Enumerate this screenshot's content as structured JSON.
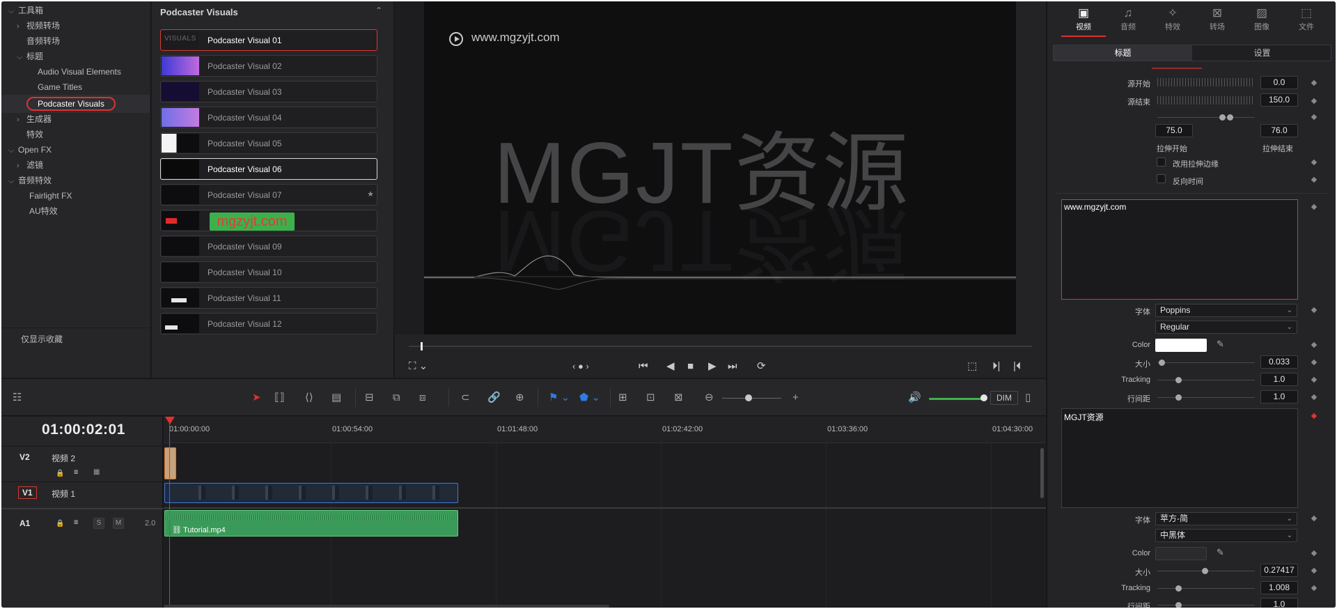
{
  "tree": {
    "items": [
      {
        "label": "工具箱",
        "chev": "⌵",
        "indent": 0
      },
      {
        "label": "视频转场",
        "chev": "›",
        "indent": 1
      },
      {
        "label": "音频转场",
        "chev": "",
        "indent": 1
      },
      {
        "label": "标题",
        "chev": "⌵",
        "indent": 1
      },
      {
        "label": "Audio Visual Elements",
        "chev": "",
        "indent": 2
      },
      {
        "label": "Game Titles",
        "chev": "",
        "indent": 2
      },
      {
        "label": "Podcaster Visuals",
        "chev": "",
        "indent": 2
      },
      {
        "label": "生成器",
        "chev": "›",
        "indent": 1
      },
      {
        "label": "特效",
        "chev": "",
        "indent": 1
      },
      {
        "label": "Open FX",
        "chev": "⌵",
        "indent": 0
      },
      {
        "label": "滤镜",
        "chev": "›",
        "indent": 1
      },
      {
        "label": "音频特效",
        "chev": "⌵",
        "indent": 0
      },
      {
        "label": "Fairlight FX",
        "chev": "",
        "indent": 1
      },
      {
        "label": "AU特效",
        "chev": "",
        "indent": 1
      }
    ],
    "favorites_only": "仅显示收藏"
  },
  "titles_panel": {
    "header": "Podcaster Visuals",
    "collapse_icon": "chevron-up-icon",
    "cards": [
      "Podcaster Visual 01",
      "Podcaster Visual 02",
      "Podcaster Visual 03",
      "Podcaster Visual 04",
      "Podcaster Visual 05",
      "Podcaster Visual 06",
      "Podcaster Visual 07",
      "",
      "Podcaster Visual 09",
      "Podcaster Visual 10",
      "Podcaster Visual 11",
      "Podcaster Visual 12"
    ],
    "thumb_label_01": "VISUALS",
    "watermark": "mgzyjt.com"
  },
  "viewer": {
    "url_text": "www.mgzyjt.com",
    "big_title": "MGJT资源"
  },
  "inspector": {
    "tabs": [
      "视频",
      "音频",
      "特效",
      "转场",
      "图像",
      "文件"
    ],
    "tab_icons": [
      "▣",
      "♫",
      "✧",
      "⊠",
      "▨",
      "⬚"
    ],
    "sub_tabs": [
      "标题",
      "设置"
    ],
    "source_start_label": "源开始",
    "source_start_value": "0.0",
    "source_end_label": "源结束",
    "source_end_value": "150.0",
    "stretch_start_value": "75.0",
    "stretch_end_value": "76.0",
    "stretch_start_label": "拉伸开始",
    "stretch_end_label": "拉伸结束",
    "use_stretch_edge_label": "改用拉伸边缘",
    "reverse_time_label": "反向时间",
    "text1": "www.mgzyjt.com",
    "font_label": "字体",
    "font1": "Poppins",
    "style1": "Regular",
    "color_label": "Color",
    "size_label": "大小",
    "size1": "0.033",
    "tracking_label": "Tracking",
    "tracking1": "1.0",
    "line_spacing_label": "行间距",
    "line_spacing1": "1.0",
    "text2": "MGJT资源",
    "font2": "苹方-简",
    "style2": "中黑体",
    "size2": "0.27417",
    "tracking2": "1.008",
    "line_spacing2": "1.0"
  },
  "toolbar": {
    "dim": "DIM"
  },
  "timeline": {
    "timecode": "01:00:02:01",
    "ruler": [
      "01:00:00:00",
      "01:00:54:00",
      "01:01:48:00",
      "01:02:42:00",
      "01:03:36:00",
      "01:04:30:00"
    ],
    "tracks": {
      "v2_id": "V2",
      "v2_name": "视频 2",
      "v1_id": "V1",
      "v1_name": "视频 1",
      "a1_id": "A1",
      "a1_level": "2.0",
      "solo": "S",
      "mute": "M"
    },
    "audio_clip": "Tutorial.mp4"
  }
}
